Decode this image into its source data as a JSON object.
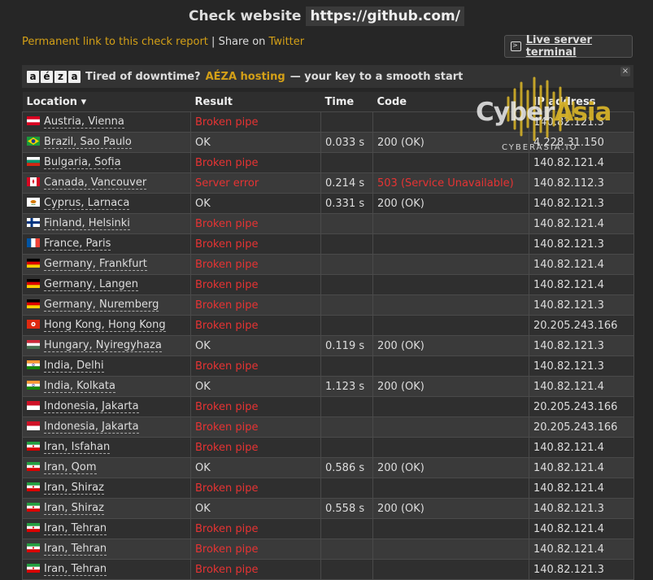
{
  "header": {
    "title": "Check website",
    "url": "https://github.com/"
  },
  "links": {
    "permanent": "Permanent link to this check report",
    "separator": "|",
    "share": "Share on",
    "twitter": "Twitter"
  },
  "terminal_button": {
    "label": "Live server terminal",
    "icon": "terminal-icon"
  },
  "ad": {
    "logo_letters": [
      "a",
      "é",
      "z",
      "a"
    ],
    "text_before": "Tired of downtime?",
    "brand": "AÉZA hosting",
    "text_after": "— your key to a smooth start",
    "close": "×"
  },
  "watermark": {
    "brand_main": "Cyber",
    "brand_accent": "Asia",
    "sub": "CYBERASIA.IO"
  },
  "table": {
    "columns": [
      "Location ▾",
      "Result",
      "Time",
      "Code",
      "IP address"
    ],
    "rows": [
      {
        "flag": "austria",
        "location": "Austria, Vienna",
        "result": "Broken pipe",
        "error": true,
        "time": "",
        "code": "",
        "code_error": false,
        "ip": "140.82.121.3"
      },
      {
        "flag": "brazil",
        "location": "Brazil, Sao Paulo",
        "result": "OK",
        "error": false,
        "time": "0.033 s",
        "code": "200 (OK)",
        "code_error": false,
        "ip": "4.228.31.150"
      },
      {
        "flag": "bulgaria",
        "location": "Bulgaria, Sofia",
        "result": "Broken pipe",
        "error": true,
        "time": "",
        "code": "",
        "code_error": false,
        "ip": "140.82.121.4"
      },
      {
        "flag": "canada",
        "location": "Canada, Vancouver",
        "result": "Server error",
        "error": true,
        "time": "0.214 s",
        "code": "503 (Service Unavailable)",
        "code_error": true,
        "ip": "140.82.112.3"
      },
      {
        "flag": "cyprus",
        "location": "Cyprus, Larnaca",
        "result": "OK",
        "error": false,
        "time": "0.331 s",
        "code": "200 (OK)",
        "code_error": false,
        "ip": "140.82.121.3"
      },
      {
        "flag": "finland",
        "location": "Finland, Helsinki",
        "result": "Broken pipe",
        "error": true,
        "time": "",
        "code": "",
        "code_error": false,
        "ip": "140.82.121.4"
      },
      {
        "flag": "france",
        "location": "France, Paris",
        "result": "Broken pipe",
        "error": true,
        "time": "",
        "code": "",
        "code_error": false,
        "ip": "140.82.121.3"
      },
      {
        "flag": "germany",
        "location": "Germany, Frankfurt",
        "result": "Broken pipe",
        "error": true,
        "time": "",
        "code": "",
        "code_error": false,
        "ip": "140.82.121.4"
      },
      {
        "flag": "germany",
        "location": "Germany, Langen",
        "result": "Broken pipe",
        "error": true,
        "time": "",
        "code": "",
        "code_error": false,
        "ip": "140.82.121.4"
      },
      {
        "flag": "germany",
        "location": "Germany, Nuremberg",
        "result": "Broken pipe",
        "error": true,
        "time": "",
        "code": "",
        "code_error": false,
        "ip": "140.82.121.3"
      },
      {
        "flag": "hongkong",
        "location": "Hong Kong, Hong Kong",
        "result": "Broken pipe",
        "error": true,
        "time": "",
        "code": "",
        "code_error": false,
        "ip": "20.205.243.166"
      },
      {
        "flag": "hungary",
        "location": "Hungary, Nyiregyhaza",
        "result": "OK",
        "error": false,
        "time": "0.119 s",
        "code": "200 (OK)",
        "code_error": false,
        "ip": "140.82.121.3"
      },
      {
        "flag": "india",
        "location": "India, Delhi",
        "result": "Broken pipe",
        "error": true,
        "time": "",
        "code": "",
        "code_error": false,
        "ip": "140.82.121.3"
      },
      {
        "flag": "india",
        "location": "India, Kolkata",
        "result": "OK",
        "error": false,
        "time": "1.123 s",
        "code": "200 (OK)",
        "code_error": false,
        "ip": "140.82.121.4"
      },
      {
        "flag": "indonesia",
        "location": "Indonesia, Jakarta",
        "result": "Broken pipe",
        "error": true,
        "time": "",
        "code": "",
        "code_error": false,
        "ip": "20.205.243.166"
      },
      {
        "flag": "indonesia",
        "location": "Indonesia, Jakarta",
        "result": "Broken pipe",
        "error": true,
        "time": "",
        "code": "",
        "code_error": false,
        "ip": "20.205.243.166"
      },
      {
        "flag": "iran",
        "location": "Iran, Isfahan",
        "result": "Broken pipe",
        "error": true,
        "time": "",
        "code": "",
        "code_error": false,
        "ip": "140.82.121.4"
      },
      {
        "flag": "iran",
        "location": "Iran, Qom",
        "result": "OK",
        "error": false,
        "time": "0.586 s",
        "code": "200 (OK)",
        "code_error": false,
        "ip": "140.82.121.4"
      },
      {
        "flag": "iran",
        "location": "Iran, Shiraz",
        "result": "Broken pipe",
        "error": true,
        "time": "",
        "code": "",
        "code_error": false,
        "ip": "140.82.121.4"
      },
      {
        "flag": "iran",
        "location": "Iran, Shiraz",
        "result": "OK",
        "error": false,
        "time": "0.558 s",
        "code": "200 (OK)",
        "code_error": false,
        "ip": "140.82.121.3"
      },
      {
        "flag": "iran",
        "location": "Iran, Tehran",
        "result": "Broken pipe",
        "error": true,
        "time": "",
        "code": "",
        "code_error": false,
        "ip": "140.82.121.4"
      },
      {
        "flag": "iran",
        "location": "Iran, Tehran",
        "result": "Broken pipe",
        "error": true,
        "time": "",
        "code": "",
        "code_error": false,
        "ip": "140.82.121.4"
      },
      {
        "flag": "iran",
        "location": "Iran, Tehran",
        "result": "Broken pipe",
        "error": true,
        "time": "",
        "code": "",
        "code_error": false,
        "ip": "140.82.121.3"
      }
    ]
  },
  "colors": {
    "accent": "#d4a017",
    "error": "#e53333",
    "background": "#262626"
  }
}
